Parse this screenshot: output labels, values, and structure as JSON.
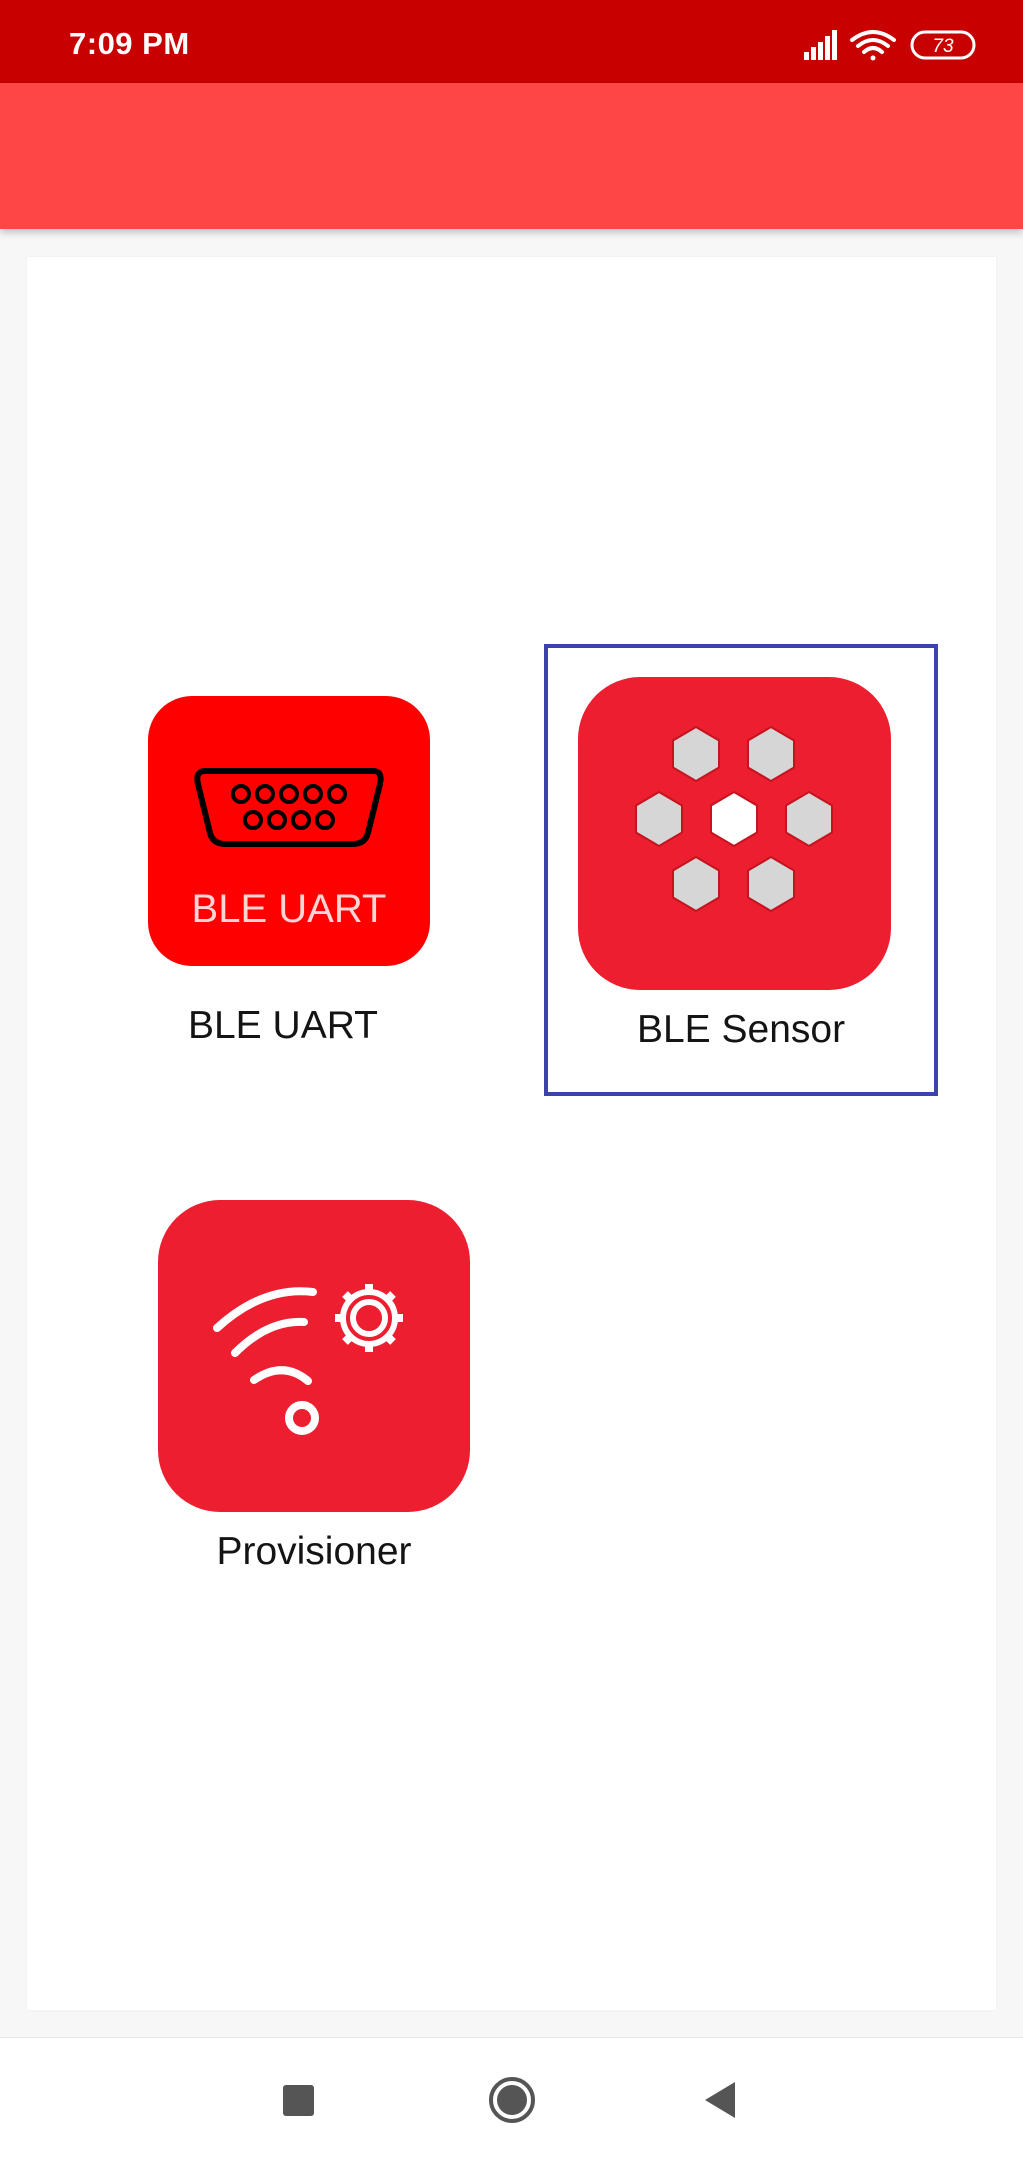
{
  "status_bar": {
    "time": "7:09 PM",
    "battery": "73",
    "icons": [
      "signal-icon",
      "wifi-icon",
      "battery-icon"
    ]
  },
  "app_bar": {
    "title": ""
  },
  "apps": [
    {
      "label": "BLE UART",
      "icon": "serial-port-icon",
      "icon_text": "BLE UART",
      "selected": false
    },
    {
      "label": "BLE Sensor",
      "icon": "hexagon-cluster-icon",
      "selected": true
    },
    {
      "label": "Provisioner",
      "icon": "wifi-gear-icon",
      "selected": false
    }
  ],
  "nav_bar": {
    "buttons": [
      "recent-apps",
      "home",
      "back"
    ]
  },
  "colors": {
    "status_bar": "#c90000",
    "app_bar": "#fe4647",
    "uart_icon_bg": "#ff0000",
    "sensor_icon_bg": "#ec1e2f",
    "hex_fill": "#d6d6d6",
    "selection_border": "#3c43ad"
  }
}
